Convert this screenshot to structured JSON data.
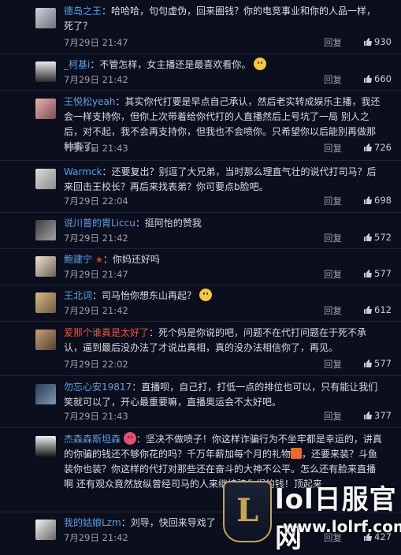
{
  "comments": [
    {
      "user": "德岛之王",
      "text": "哈哈哈，句句虚伪，回来圈钱？你的电竞事业和你的人品一样，死了？",
      "time": "7月29日 21:47",
      "reply": "回复",
      "likes": "930"
    },
    {
      "user": "_柯基i",
      "text": "不管怎样，女主播还是最喜欢看你。",
      "time": "7月29日 21:42",
      "reply": "回复",
      "likes": "660"
    },
    {
      "user": "王悦松yeah",
      "text": "其实你代打要是早点自己承认，然后老实转成娱乐主播，我还会一样支持你，但你上次带着给你代打的人直播然后上号坑了一局 别人之后，对不起，我不会再支持你，但我也不会喷你。只希望你以后能别再做那种事了。",
      "time": "7月29日 21:43",
      "reply": "回复",
      "likes": "726"
    },
    {
      "user": "Warmck",
      "text": "还要复出？别逗了大兄弟，当时那么理直气壮的说代打司马？后来回击王校长？再后来找表弟？你可要点b脸吧。",
      "time": "7月29日 22:04",
      "reply": "回复",
      "likes": "698"
    },
    {
      "user": "说川普的胃Liccu",
      "text": "挺阿怡的赞我",
      "time": "7月29日 21:42",
      "reply": "回复",
      "likes": "572"
    },
    {
      "user": "鲍建宁",
      "text": "你妈还好吗",
      "time": "7月29日 21:47",
      "reply": "回复",
      "likes": "577"
    },
    {
      "user": "王北词",
      "text": "司马怡你想东山再起？",
      "time": "7月29日 21:42",
      "reply": "回复",
      "likes": "612"
    },
    {
      "user": "爱那个谁真是太好了",
      "text": "死个妈是你说的吧，问题不在代打问题在于死不承认，逼到最后没办法了才说出真相，真的没办法相信你了，再见。",
      "time": "7月29日 22:02",
      "reply": "回复",
      "likes": "577"
    },
    {
      "user": "勿忘心安19817",
      "text": "直播呗，自己打，打低一点的排位也可以，只有能让我们笑就可以了，开心最重要嘛，直播奥运会不太好吧。",
      "time": "7月29日 21:43",
      "reply": "回复",
      "likes": "377"
    },
    {
      "user": "杰森森斯坦森",
      "text_a": "坚决不做喷子！你这样诈骗行为不坐牢都是幸运的，讲真的你骗的钱还不够你花的吗？千万年薪加每个月的礼物",
      "text_b": "，还要来装？斗鱼装你也装？你这样的代打对那些还在奋斗的大神不公平。怎么还有脸来直播 啊 还有观众竟然放纵曾经司马的人来继续骗你们的钱！顶起来",
      "time": "",
      "reply": "",
      "likes": ""
    },
    {
      "user": "我的姑娘Lzm",
      "text": "刘导，快回来导戏了",
      "time": "7月29日 21:42",
      "reply": "回复",
      "likes": "427"
    }
  ],
  "watermark": {
    "logo": "L",
    "title": "lol日服官网",
    "url": "www.lolrf.com"
  }
}
